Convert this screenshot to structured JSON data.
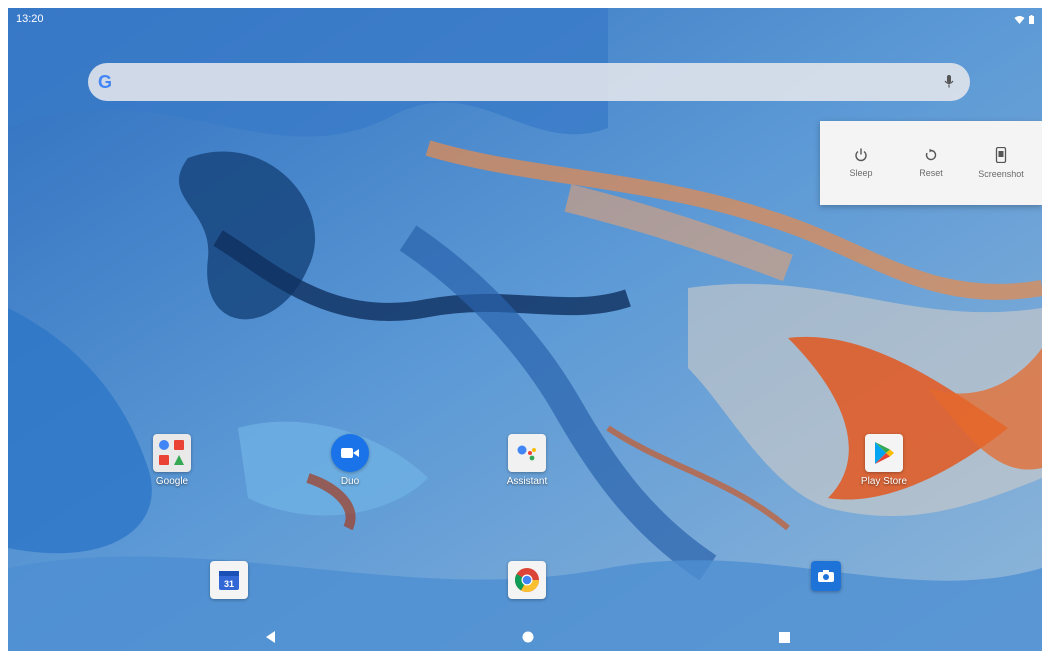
{
  "status_bar": {
    "time": "13:20",
    "icons": [
      "wifi-icon",
      "battery-icon"
    ]
  },
  "search": {
    "logo": "G",
    "icon": "microphone-icon"
  },
  "power_menu": {
    "options": [
      {
        "label": "Sleep",
        "icon": "power-icon"
      },
      {
        "label": "Reset",
        "icon": "restart-icon"
      },
      {
        "label": "Screenshot",
        "icon": "screenshot-icon"
      }
    ]
  },
  "apps": [
    {
      "label": "Google",
      "icon": "google-folder-icon"
    },
    {
      "label": "Duo",
      "icon": "duo-icon"
    },
    {
      "label": "Assistant",
      "icon": "assistant-icon"
    },
    {
      "label": "Play Store",
      "icon": "play-store-icon"
    }
  ],
  "dock": [
    {
      "icon": "calendar-icon",
      "text": "31"
    },
    {
      "icon": "chrome-icon"
    },
    {
      "icon": "camera-icon"
    }
  ],
  "navigation": {
    "buttons": [
      "back-icon",
      "home-icon",
      "recents-icon"
    ]
  },
  "colors": {
    "wallpaper_blue": "#3f86cf",
    "wallpaper_orange": "#e0642e",
    "menu_background": "#f4f4f4"
  }
}
